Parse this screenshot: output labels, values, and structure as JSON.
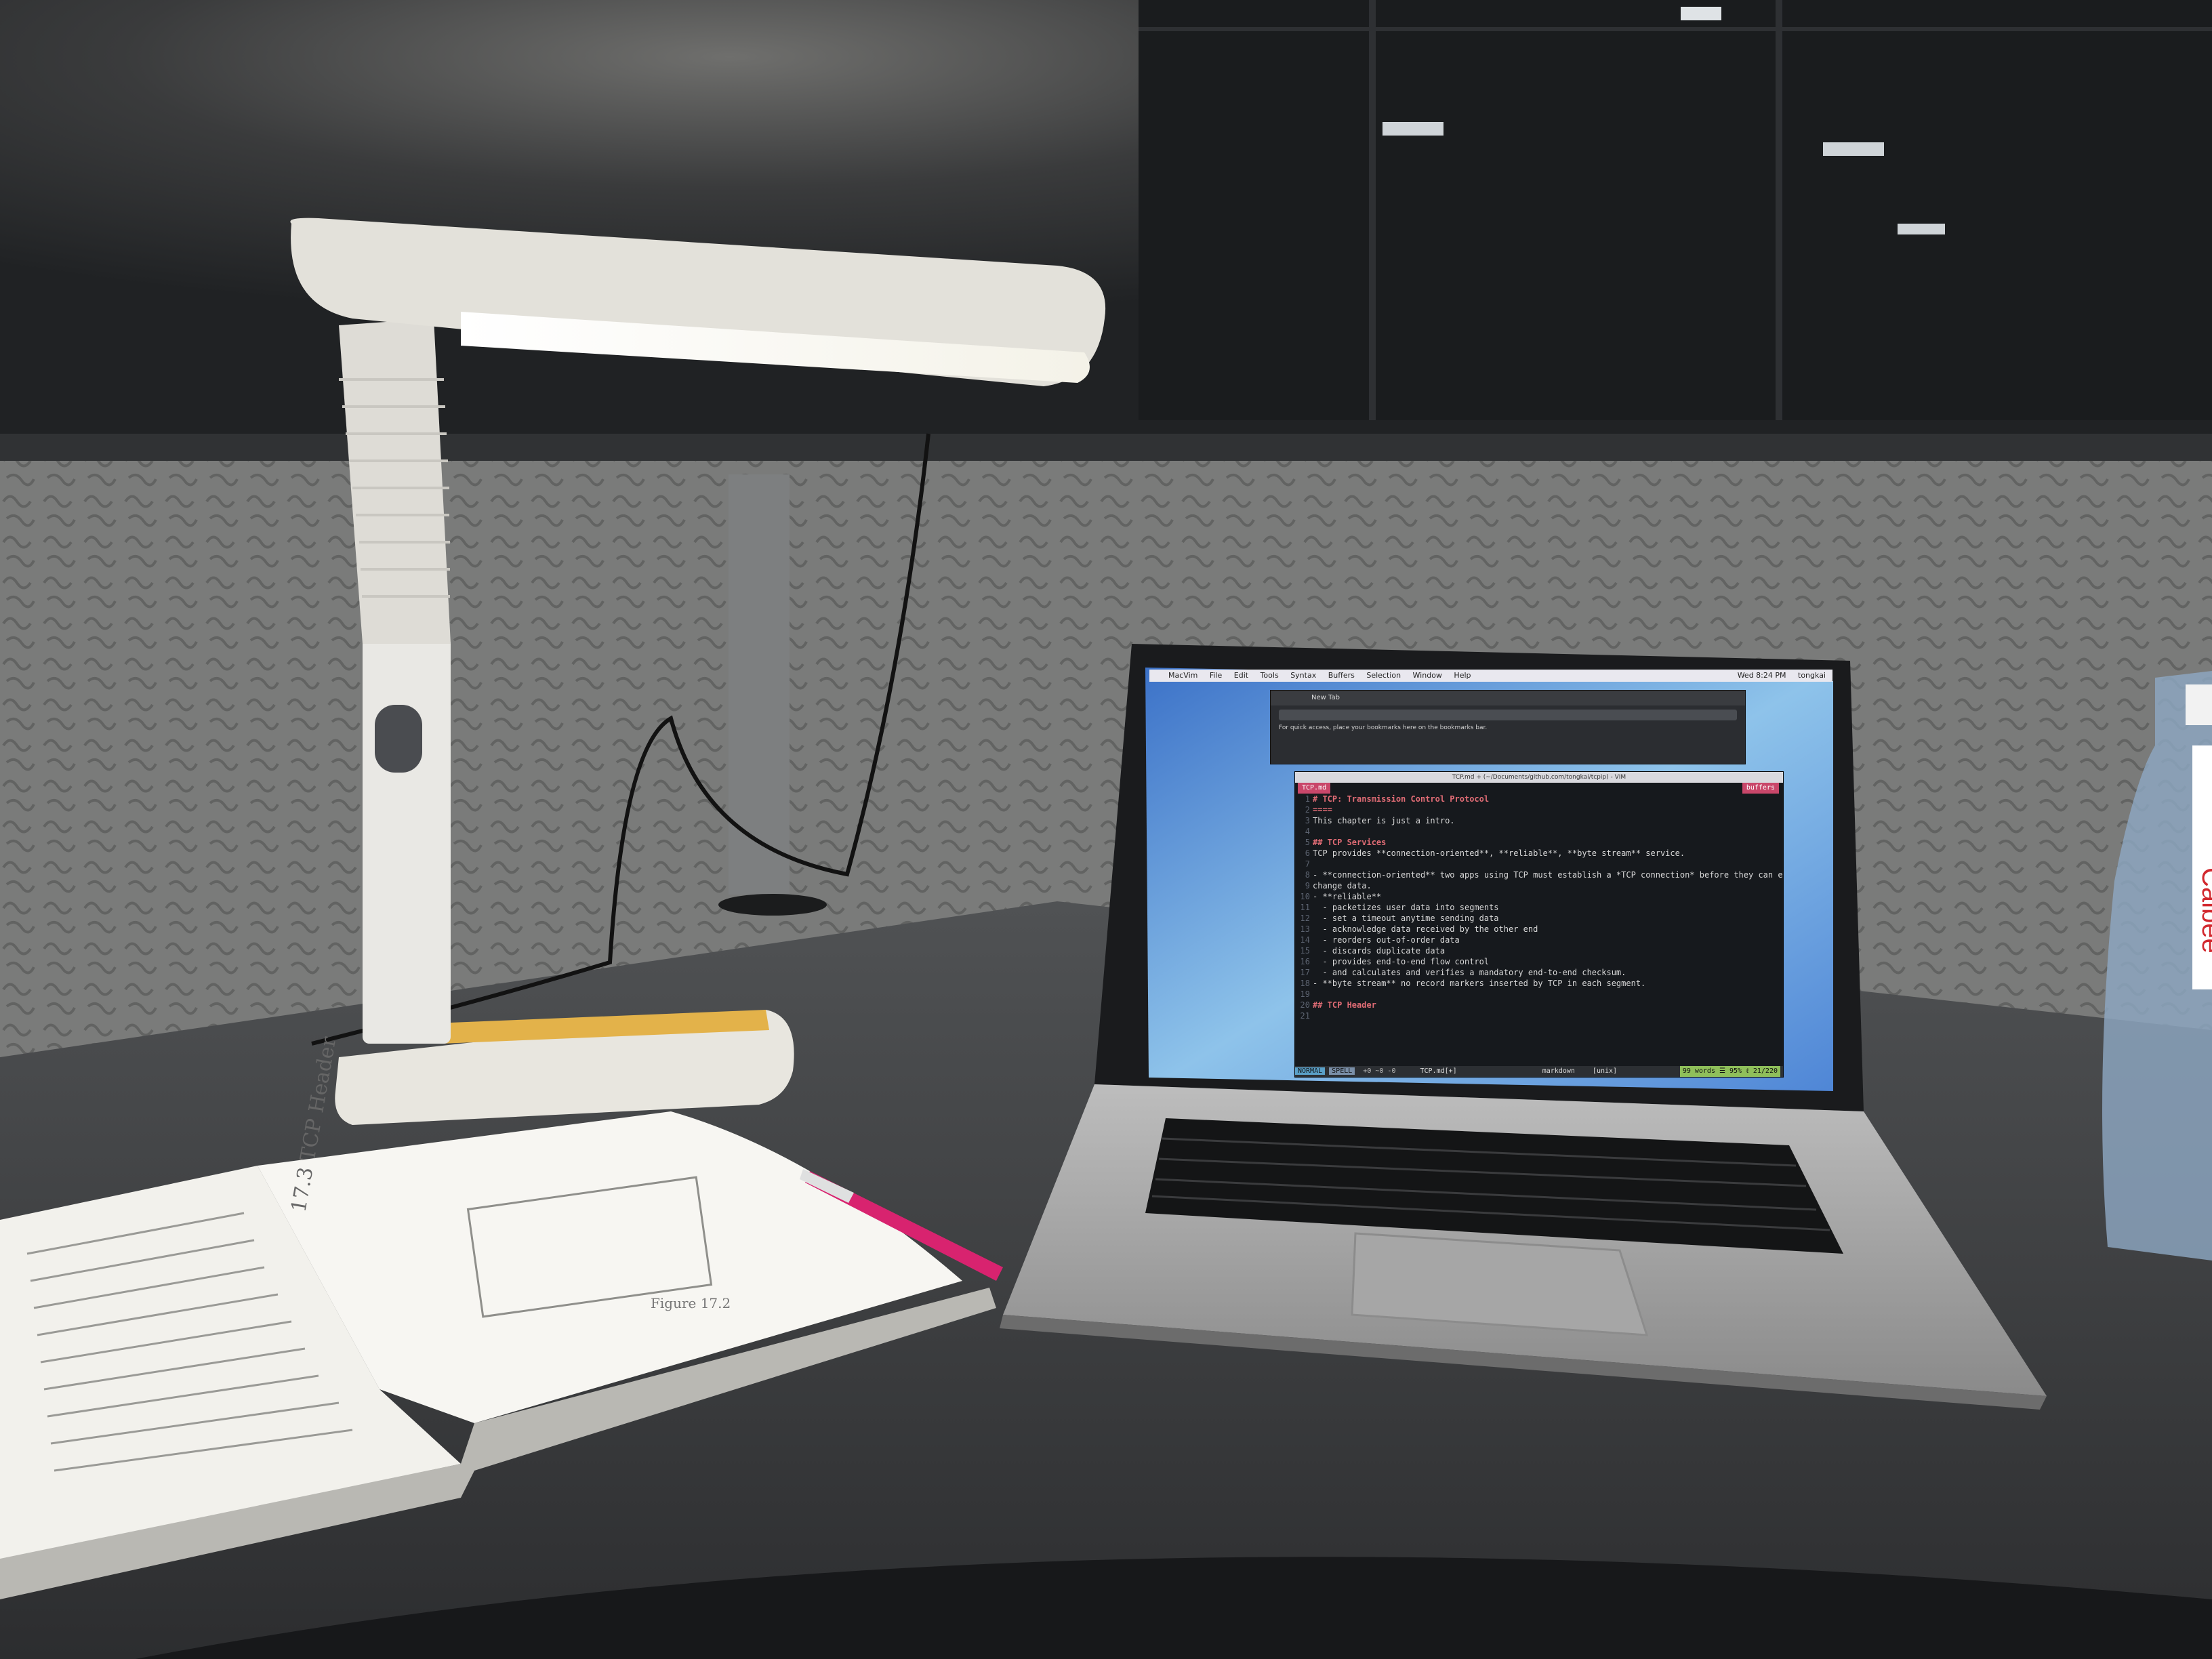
{
  "scene": {
    "description_items": [
      "desk-lamp",
      "laptop",
      "open-book",
      "pen",
      "water-bottle"
    ],
    "bottle_label": "Calbee"
  },
  "menubar": {
    "app": "MacVim",
    "items": [
      "File",
      "Edit",
      "Tools",
      "Syntax",
      "Buffers",
      "Selection",
      "Window",
      "Help"
    ],
    "clock": "Wed 8:24 PM",
    "user": "tongkai"
  },
  "browser": {
    "tab_title": "New Tab",
    "bookmark_hint": "For quick access, place your bookmarks here on the bookmarks bar."
  },
  "vim": {
    "window_title": "TCP.md + (~/Documents/github.com/tongkai/tcpip) - VIM",
    "tab_label": "TCP.md",
    "buffers_label": "buffers",
    "lines": [
      {
        "n": "1",
        "text": "# TCP: Transmission Control Protocol",
        "heading": true
      },
      {
        "n": "2",
        "text": "====",
        "heading": true
      },
      {
        "n": "3",
        "text": "This chapter is just a intro.",
        "heading": false
      },
      {
        "n": "4",
        "text": "",
        "heading": false
      },
      {
        "n": "5",
        "text": "## TCP Services",
        "heading": true
      },
      {
        "n": "6",
        "text": "TCP provides **connection-oriented**, **reliable**, **byte stream** service.",
        "heading": false
      },
      {
        "n": "7",
        "text": "",
        "heading": false
      },
      {
        "n": "8",
        "text": "- **connection-oriented** two apps using TCP must establish a *TCP connection* before they can ex",
        "heading": false
      },
      {
        "n": "9",
        "text": "change data.",
        "heading": false
      },
      {
        "n": "10",
        "text": "- **reliable**",
        "heading": false
      },
      {
        "n": "11",
        "text": "  - packetizes user data into segments",
        "heading": false
      },
      {
        "n": "12",
        "text": "  - set a timeout anytime sending data",
        "heading": false
      },
      {
        "n": "13",
        "text": "  - acknowledge data received by the other end",
        "heading": false
      },
      {
        "n": "14",
        "text": "  - reorders out-of-order data",
        "heading": false
      },
      {
        "n": "15",
        "text": "  - discards duplicate data",
        "heading": false
      },
      {
        "n": "16",
        "text": "  - provides end-to-end flow control",
        "heading": false
      },
      {
        "n": "17",
        "text": "  - and calculates and verifies a mandatory end-to-end checksum.",
        "heading": false
      },
      {
        "n": "18",
        "text": "- **byte stream** no record markers inserted by TCP in each segment.",
        "heading": false
      },
      {
        "n": "19",
        "text": "",
        "heading": false
      },
      {
        "n": "20",
        "text": "## TCP Header",
        "heading": true
      },
      {
        "n": "21",
        "text": "",
        "heading": false
      }
    ],
    "status": {
      "mode": "NORMAL",
      "spell": "SPELL",
      "diff": "+0 ~0 -0",
      "file": "TCP.md[+]",
      "filetype": "markdown",
      "format": "[unix]",
      "position": "99 words ☰ 95% ℓ 21/220"
    }
  },
  "book": {
    "section_heading": "17.3  TCP Header",
    "figure_caption": "Figure 17.2"
  }
}
